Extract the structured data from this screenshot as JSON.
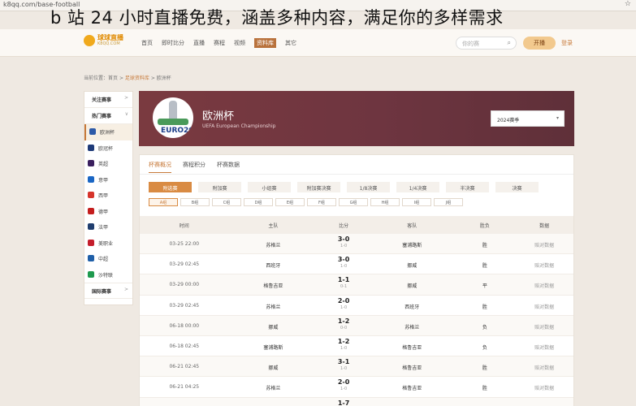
{
  "browser": {
    "url": "k8qq.com/base-football",
    "star_icon": "star-icon"
  },
  "overlay_title": "b 站 24 小时直播免费，涵盖多种内容，满足你的多样需求",
  "nav": {
    "logo_text": "球球直播",
    "logo_sub": "K8QQ.COM",
    "links": [
      "首页",
      "即时比分",
      "直播",
      "赛程",
      "视频",
      "资料库",
      "其它"
    ],
    "active_index": 5,
    "search_placeholder": "你的赛",
    "upload_label": "开播",
    "login_label": "登录"
  },
  "breadcrumb": {
    "prefix": "当前位置：",
    "home": "首页",
    "section": "足球资料库",
    "current": "欧洲杯",
    "sep": ">"
  },
  "sidebar": {
    "sections": [
      {
        "label": "关注赛事",
        "arrow": ">"
      },
      {
        "label": "热门赛事",
        "arrow": "∨"
      }
    ],
    "items": [
      {
        "label": "欧洲杯",
        "color": "#2d5aa8"
      },
      {
        "label": "欧冠杯",
        "color": "#1e3a78"
      },
      {
        "label": "英超",
        "color": "#3a1f5e"
      },
      {
        "label": "意甲",
        "color": "#1a66c4"
      },
      {
        "label": "西甲",
        "color": "#d6342b"
      },
      {
        "label": "德甲",
        "color": "#c41d1d"
      },
      {
        "label": "法甲",
        "color": "#1f3d6e"
      },
      {
        "label": "美职业",
        "color": "#c41d2b"
      },
      {
        "label": "中超",
        "color": "#1f5fa8"
      },
      {
        "label": "沙特联",
        "color": "#1e9a4e"
      }
    ],
    "bottom_section": {
      "label": "国际赛事",
      "arrow": ">"
    }
  },
  "banner": {
    "name": "欧洲杯",
    "english": "UEFA European Championship",
    "emblem_text": "EURO2024",
    "season": "2024赛季"
  },
  "tabs": [
    "杯赛概况",
    "赛程积分",
    "杯赛数据"
  ],
  "stages": [
    "附选赛",
    "附加赛",
    "小组赛",
    "附加赛决赛",
    "1/8决赛",
    "1/4决赛",
    "半决赛",
    "决赛"
  ],
  "groups": [
    "A组",
    "B组",
    "C组",
    "D组",
    "E组",
    "F组",
    "G组",
    "H组",
    "I组",
    "J组"
  ],
  "table": {
    "headers": [
      "时间",
      "主队",
      "比分",
      "客队",
      "胜负",
      "数据"
    ],
    "rows": [
      {
        "time": "03-25 22:00",
        "home": "苏格兰",
        "score": "3-0",
        "half": "1-0",
        "away": "塞浦路斯",
        "result": "胜",
        "data": "赔对数据"
      },
      {
        "time": "03-29 02:45",
        "home": "西班牙",
        "score": "3-0",
        "half": "1-0",
        "away": "挪威",
        "result": "胜",
        "data": "赔对数据"
      },
      {
        "time": "03-29 00:00",
        "home": "格鲁吉亚",
        "score": "1-1",
        "half": "0-1",
        "away": "挪威",
        "result": "平",
        "data": "赔对数据"
      },
      {
        "time": "03-29 02:45",
        "home": "苏格兰",
        "score": "2-0",
        "half": "1-0",
        "away": "西班牙",
        "result": "胜",
        "data": "赔对数据"
      },
      {
        "time": "06-18 00:00",
        "home": "挪威",
        "score": "1-2",
        "half": "0-0",
        "away": "苏格兰",
        "result": "负",
        "data": "赔对数据"
      },
      {
        "time": "06-18 02:45",
        "home": "塞浦路斯",
        "score": "1-2",
        "half": "1-0",
        "away": "格鲁吉亚",
        "result": "负",
        "data": "赔对数据"
      },
      {
        "time": "06-21 02:45",
        "home": "挪威",
        "score": "3-1",
        "half": "1-0",
        "away": "格鲁吉亚",
        "result": "胜",
        "data": "赔对数据"
      },
      {
        "time": "06-21 04:25",
        "home": "苏格兰",
        "score": "2-0",
        "half": "1-0",
        "away": "格鲁吉亚",
        "result": "胜",
        "data": "赔对数据"
      },
      {
        "time": "",
        "home": "",
        "score": "1-7",
        "half": "",
        "away": "",
        "result": "",
        "data": ""
      }
    ]
  }
}
